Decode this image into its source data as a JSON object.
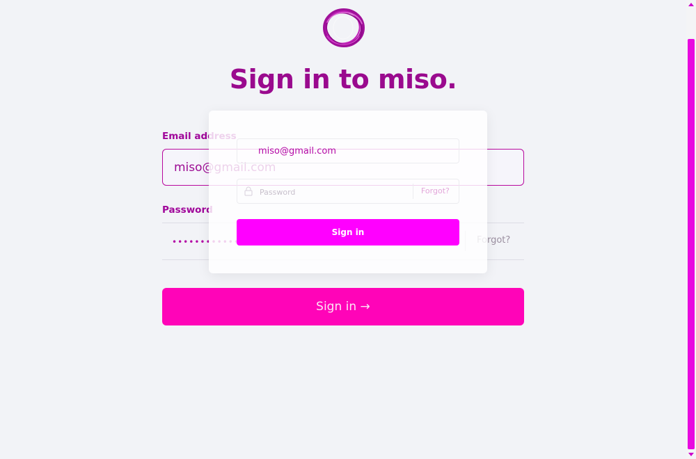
{
  "header": {
    "title": "Sign in to miso."
  },
  "form": {
    "email_label": "Email address",
    "email_value": "miso@gmail.com",
    "password_label": "Password",
    "password_value": "••••••••••••••••",
    "forgot_label": "Forgot?",
    "signin_label": "Sign in →"
  },
  "overlay": {
    "email_value": "miso@gmail.com",
    "password_placeholder": "Password",
    "forgot_label": "Forgot?",
    "signin_label": "Sign in"
  },
  "colors": {
    "brand": "#9a0a8e",
    "accent": "#ff04b8",
    "overlay_button": "#ff00ff",
    "background": "#f2f3f7"
  },
  "icons": {
    "logo": "miso-logo-icon",
    "lock": "lock-icon"
  }
}
